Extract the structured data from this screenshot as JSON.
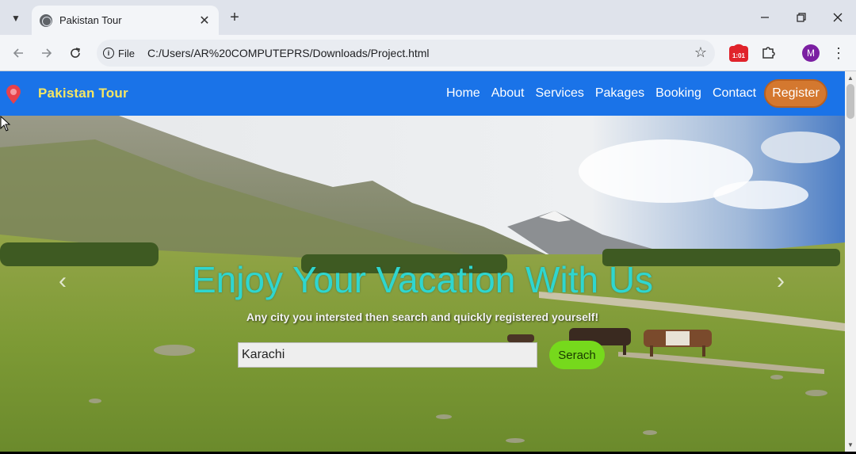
{
  "browser": {
    "tab_title": "Pakistan Tour",
    "close_tab": "✕",
    "new_tab": "+",
    "site_info_label": "File",
    "url": "C:/Users/AR%20COMPUTEPRS/Downloads/Project.html",
    "extension_recorder_time": "1:01",
    "profile_initial": "M",
    "icons": [
      "tab-search-icon",
      "globe-icon",
      "close-icon",
      "plus-icon",
      "minimize-icon",
      "restore-icon",
      "window-close-icon",
      "back-icon",
      "forward-icon",
      "reload-icon",
      "info-icon",
      "star-icon",
      "recorder-icon",
      "puzzle-icon",
      "kebab-menu-icon"
    ]
  },
  "site": {
    "brand": "Pakistan Tour",
    "nav": [
      "Home",
      "About",
      "Services",
      "Pakages",
      "Booking",
      "Contact"
    ],
    "register_label": "Register",
    "hero": {
      "title": "Enjoy Your Vacation With Us",
      "subtitle": "Any city you intersted then search and quickly registered yourself!",
      "search_value": "Karachi",
      "search_button": "Serach"
    },
    "colors": {
      "navbar": "#1a73e8",
      "brand": "#f5e663",
      "register": "#d4782f",
      "hero_title": "#2fd6cf",
      "search_button": "#76d91c"
    }
  }
}
